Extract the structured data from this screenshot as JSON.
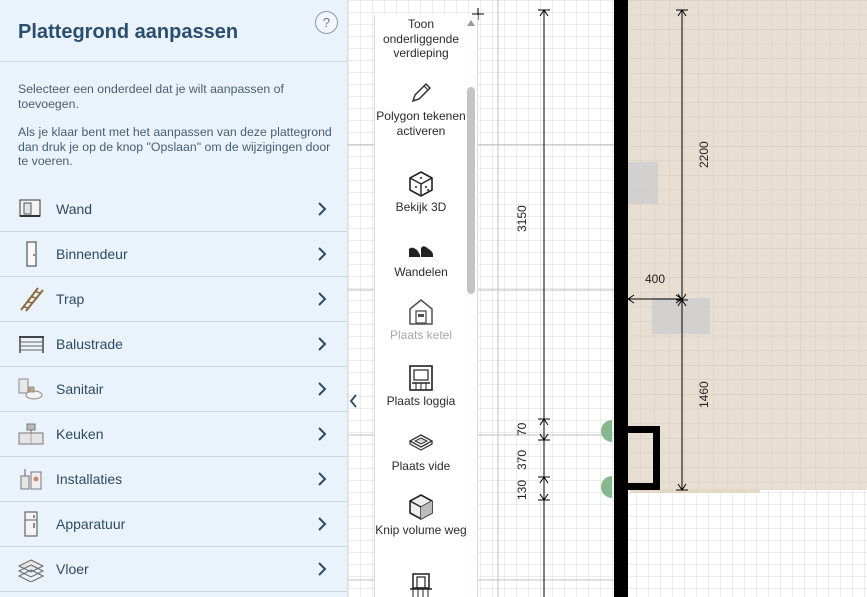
{
  "sidebar": {
    "title": "Plattegrond aanpassen",
    "help_label": "?",
    "intro": "Selecteer een onderdeel dat je wilt aanpassen of toevoegen.",
    "instructions": "Als je klaar bent met het aanpassen van deze plattegrond dan druk je op de knop \"Opslaan\" om de wijzigingen door te voeren.",
    "items": [
      {
        "label": "Wand",
        "icon": "wall-icon"
      },
      {
        "label": "Binnendeur",
        "icon": "door-icon"
      },
      {
        "label": "Trap",
        "icon": "stairs-icon"
      },
      {
        "label": "Balustrade",
        "icon": "balustrade-icon"
      },
      {
        "label": "Sanitair",
        "icon": "sanitary-icon"
      },
      {
        "label": "Keuken",
        "icon": "kitchen-icon"
      },
      {
        "label": "Installaties",
        "icon": "installations-icon"
      },
      {
        "label": "Apparatuur",
        "icon": "appliance-icon"
      },
      {
        "label": "Vloer",
        "icon": "floor-icon"
      }
    ]
  },
  "toolbar": {
    "tools": [
      {
        "label": "Toon onderliggende verdieping",
        "icon": "underlying-floor-icon",
        "enabled": true
      },
      {
        "label": "Polygon tekenen activeren",
        "icon": "pencil-icon",
        "enabled": true
      },
      {
        "label": "Bekijk 3D",
        "icon": "cube-3d-icon",
        "enabled": true
      },
      {
        "label": "Wandelen",
        "icon": "walk-shoes-icon",
        "enabled": true
      },
      {
        "label": "Plaats ketel",
        "icon": "boiler-icon",
        "enabled": false
      },
      {
        "label": "Plaats loggia",
        "icon": "loggia-icon",
        "enabled": true
      },
      {
        "label": "Plaats vide",
        "icon": "vide-icon",
        "enabled": true
      },
      {
        "label": "Knip volume weg",
        "icon": "cut-volume-icon",
        "enabled": true
      },
      {
        "label": "",
        "icon": "balcony-icon",
        "enabled": true
      }
    ]
  },
  "floorplan": {
    "dimensions": [
      "3150",
      "2200",
      "400",
      "1460",
      "70",
      "370",
      "130"
    ],
    "colors": {
      "grid": "#d4d4d4",
      "grid_bg": "#ffffff",
      "room": "#e8dfd2",
      "room_grid": "#d6cabb",
      "wall": "#000000",
      "plant": "#7fb08a",
      "furniture": "#d2d2d2"
    }
  }
}
